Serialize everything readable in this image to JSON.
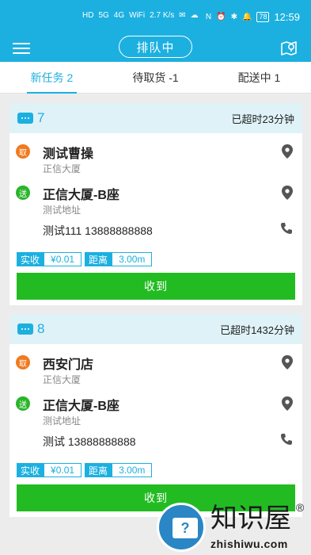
{
  "status_bar": {
    "left_glyphs": [
      "HD",
      "5G",
      "4G",
      "WiFi",
      "2.7 K/s",
      "✉",
      "☁"
    ],
    "right_glyphs": [
      "N",
      "⏰",
      "✱",
      "🔔"
    ],
    "battery": "78",
    "time": "12:59"
  },
  "header": {
    "queue_label": "排队中",
    "menu_icon": "menu-icon",
    "map_icon": "map-pin-icon"
  },
  "tabs": [
    {
      "label": "新任务 2",
      "active": true
    },
    {
      "label": "待取货 -1",
      "active": false
    },
    {
      "label": "配送中 1",
      "active": false
    }
  ],
  "orders": [
    {
      "number": "7",
      "overdue": "已超时23分钟",
      "pickup_badge": "取",
      "pickup_name": "测试曹操",
      "pickup_addr": "正信大厦",
      "delivery_badge": "送",
      "delivery_name": "正信大厦-B座",
      "delivery_addr": "测试地址",
      "contact": "测试111 13888888888",
      "paid_label": "实收",
      "paid_value": "¥0.01",
      "distance_label": "距离",
      "distance_value": "3.00m",
      "button_label": "收到"
    },
    {
      "number": "8",
      "overdue": "已超时1432分钟",
      "pickup_badge": "取",
      "pickup_name": "西安门店",
      "pickup_addr": "正信大厦",
      "delivery_badge": "送",
      "delivery_name": "正信大厦-B座",
      "delivery_addr": "测试地址",
      "contact": "测试 13888888888",
      "paid_label": "实收",
      "paid_value": "¥0.01",
      "distance_label": "距离",
      "distance_value": "3.00m",
      "button_label": "收到"
    }
  ],
  "watermark": {
    "title": "知识屋",
    "reg": "®",
    "url": "zhishiwu.com",
    "monitor_mark": "?"
  },
  "colors": {
    "primary": "#1cb0e0",
    "pickup": "#f07a1e",
    "delivery": "#2ab52a",
    "button": "#22bc22"
  }
}
